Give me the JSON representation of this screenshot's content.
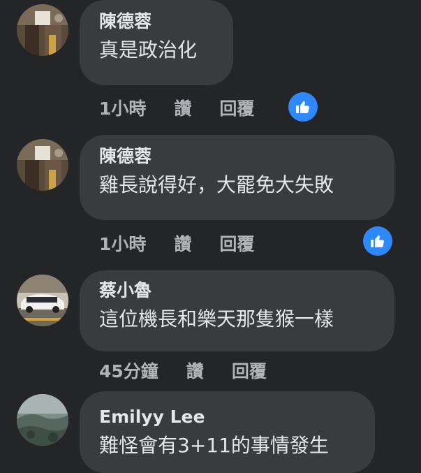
{
  "colors": {
    "background": "#242526",
    "bubble": "#3a3b3c",
    "text_primary": "#e4e6eb",
    "text_secondary": "#b0b3b8",
    "like_reaction": "#2e89ff"
  },
  "comments": [
    {
      "author": "陳德蓉",
      "text": "真是政治化",
      "time": "1小時",
      "like_label": "讚",
      "reply_label": "回覆",
      "reaction_icon": "thumbs-up-icon"
    },
    {
      "author": "陳德蓉",
      "text": "雞長說得好，大罷免大失敗",
      "time": "1小時",
      "like_label": "讚",
      "reply_label": "回覆",
      "reaction_icon": "thumbs-up-icon"
    },
    {
      "author": "蔡小魯",
      "text": "這位機長和樂天那隻猴一樣",
      "time": "45分鐘",
      "like_label": "讚",
      "reply_label": "回覆"
    },
    {
      "author": "Emilyy Lee",
      "text": "難怪會有3+11的事情發生"
    }
  ]
}
